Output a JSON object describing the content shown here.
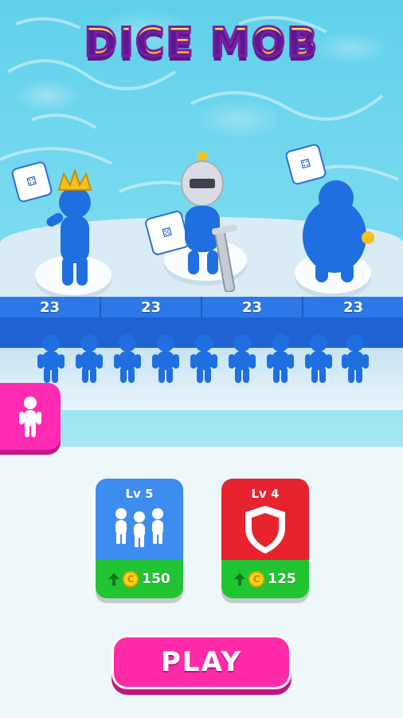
{
  "title": "DICE MOB",
  "wall": {
    "values": [
      "23",
      "23",
      "23",
      "23"
    ]
  },
  "side_button": {
    "icon": "person-icon"
  },
  "cards": [
    {
      "level": "Lv 5",
      "icon": "crowd-icon",
      "price": "150",
      "color": "#3d8cf0"
    },
    {
      "level": "Lv 4",
      "icon": "shield-icon",
      "price": "125",
      "color": "#e6232f"
    }
  ],
  "play_label": "PLAY",
  "colors": {
    "accent": "#ff2aa8",
    "crowd": "#1f6fe0",
    "buy": "#21c431"
  }
}
